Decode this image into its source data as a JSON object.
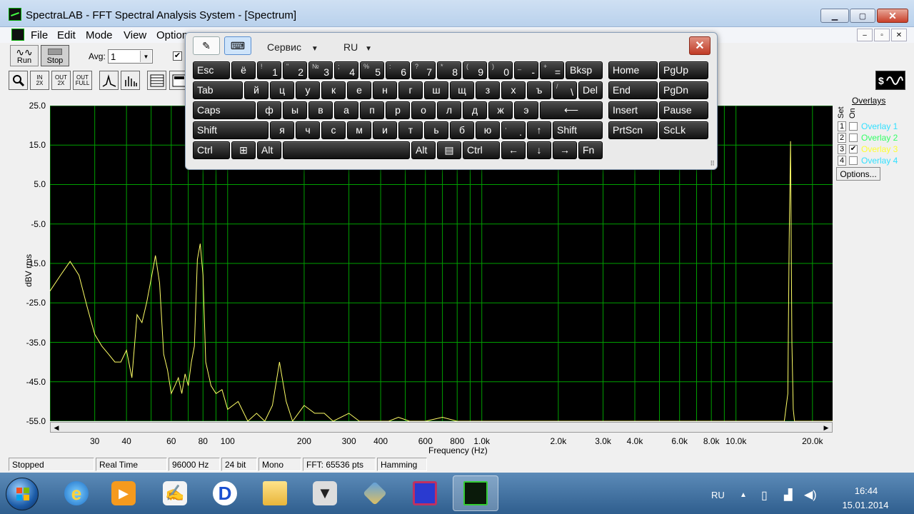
{
  "window": {
    "title": "SpectraLAB - FFT Spectral Analysis System - [Spectrum]",
    "minimize": "▁",
    "maximize": "▢",
    "close": "✕"
  },
  "menu": {
    "items": [
      "File",
      "Edit",
      "Mode",
      "View",
      "Options"
    ],
    "mdi": [
      "–",
      "▫",
      "✕"
    ]
  },
  "toolbar": {
    "run_label": "Run",
    "stop_label": "Stop",
    "avg_label": "Avg:",
    "avg_value": "1",
    "check_mark": "✔",
    "zoom_buttons": [
      {
        "top": "IN",
        "bottom": "2X"
      },
      {
        "top": "OUT",
        "bottom": "2X"
      },
      {
        "top": "OUT",
        "bottom": "FULL"
      }
    ]
  },
  "plot": {
    "ylabel": "dBV rms",
    "xlabel": "Frequency (Hz)",
    "y_ticks": [
      "25.0",
      "15.0",
      "5.0",
      "-5.0",
      "-15.0",
      "-25.0",
      "-35.0",
      "-45.0",
      "-55.0"
    ],
    "x_ticks": [
      "30",
      "40",
      "60",
      "80",
      "100",
      "200",
      "300",
      "400",
      "600",
      "800",
      "1.0k",
      "2.0k",
      "3.0k",
      "4.0k",
      "6.0k",
      "8.0k",
      "10.0k",
      "20.0k"
    ]
  },
  "chart_data": {
    "type": "line",
    "xlabel": "Frequency (Hz)",
    "ylabel": "dBV rms",
    "xscale": "log",
    "xlim": [
      20,
      24000
    ],
    "ylim": [
      -55,
      25
    ],
    "grid": true,
    "background": "#000000",
    "grid_color": "#00a000",
    "series": [
      {
        "color": "#ffff66",
        "x": [
          20,
          22,
          24,
          26,
          28,
          30,
          32,
          34,
          36,
          38,
          40,
          42,
          44,
          46,
          48,
          50,
          52,
          54,
          56,
          58,
          60,
          62,
          64,
          66,
          68,
          70,
          72,
          74,
          76,
          78,
          80,
          82,
          84,
          86,
          90,
          95,
          100,
          110,
          120,
          130,
          140,
          150,
          160,
          170,
          180,
          200,
          220,
          240,
          260,
          300,
          330,
          360,
          400,
          430,
          470,
          520,
          600,
          700,
          800,
          900,
          1000,
          1500,
          2000,
          3000,
          5000,
          8000,
          10000,
          12000,
          14000,
          15000,
          15500,
          16000,
          16200,
          16400,
          16600,
          16800,
          17000,
          18000,
          20000,
          24000
        ],
        "y": [
          -22,
          -18,
          -14.5,
          -18,
          -26,
          -33,
          -36,
          -38,
          -40,
          -40,
          -37,
          -44,
          -28,
          -30,
          -25,
          -19,
          -13,
          -20,
          -38,
          -42,
          -48,
          -46,
          -44,
          -48,
          -43,
          -46,
          -40,
          -36,
          -14,
          -10,
          -18,
          -40,
          -43,
          -46,
          -48,
          -47,
          -52,
          -50,
          -55,
          -53,
          -55,
          -51,
          -40,
          -50,
          -55,
          -51,
          -53,
          -53,
          -55,
          -53,
          -55,
          -55,
          -55,
          -55,
          -54,
          -55,
          -55,
          -54,
          -55,
          -55,
          -55,
          -55,
          -55,
          -55,
          -55,
          -55,
          -55,
          -55,
          -55,
          -55,
          -55,
          -48,
          -9,
          16,
          -35,
          -52,
          -55,
          -55,
          -55,
          -55
        ]
      }
    ]
  },
  "overlays": {
    "title": "Overlays",
    "set_label": "Set",
    "on_label": "On",
    "items": [
      {
        "num": "1",
        "label": "Overlay 1",
        "checked": "",
        "color": "#33e0ff"
      },
      {
        "num": "2",
        "label": "Overlay 2",
        "checked": "",
        "color": "#33ff66"
      },
      {
        "num": "3",
        "label": "Overlay 3",
        "checked": "✔",
        "color": "#ffff33"
      },
      {
        "num": "4",
        "label": "Overlay 4",
        "checked": "",
        "color": "#33e0ff"
      }
    ],
    "options_label": "Options..."
  },
  "status": {
    "fields": [
      "Stopped",
      "Real Time",
      "96000 Hz",
      "24 bit",
      "Mono",
      "FFT: 65536 pts",
      "Hamming"
    ]
  },
  "osk": {
    "menu_service": "Сервис",
    "menu_lang": "RU",
    "close": "✕",
    "rows": [
      [
        {
          "m": "Esc",
          "w": 52
        },
        {
          "m": "ё",
          "w": 34
        },
        {
          "s": "!",
          "b": "1",
          "w": 34
        },
        {
          "s": "\"",
          "b": "2",
          "w": 34
        },
        {
          "s": "№",
          "b": "3",
          "w": 34
        },
        {
          "s": ";",
          "b": "4",
          "w": 34
        },
        {
          "s": "%",
          "b": "5",
          "w": 34
        },
        {
          "s": ":",
          "b": "6",
          "w": 34
        },
        {
          "s": "?",
          "b": "7",
          "w": 34
        },
        {
          "s": "*",
          "b": "8",
          "w": 34
        },
        {
          "s": "(",
          "b": "9",
          "w": 34
        },
        {
          "s": ")",
          "b": "0",
          "w": 34
        },
        {
          "s": "_",
          "b": "-",
          "w": 34
        },
        {
          "s": "+",
          "b": "=",
          "w": 34
        },
        {
          "m": "Bksp",
          "w": 52
        }
      ],
      [
        {
          "m": "Tab",
          "w": 70
        },
        {
          "m": "й",
          "w": 34
        },
        {
          "m": "ц",
          "w": 34
        },
        {
          "m": "у",
          "w": 34
        },
        {
          "m": "к",
          "w": 34
        },
        {
          "m": "е",
          "w": 34
        },
        {
          "m": "н",
          "w": 34
        },
        {
          "m": "г",
          "w": 34
        },
        {
          "m": "ш",
          "w": 34
        },
        {
          "m": "щ",
          "w": 34
        },
        {
          "m": "з",
          "w": 34
        },
        {
          "m": "х",
          "w": 34
        },
        {
          "m": "ъ",
          "w": 34
        },
        {
          "s": "/",
          "b": "\\",
          "w": 34
        },
        {
          "m": "Del",
          "w": 34
        }
      ],
      [
        {
          "m": "Caps",
          "w": 88
        },
        {
          "m": "ф",
          "w": 34
        },
        {
          "m": "ы",
          "w": 34
        },
        {
          "m": "в",
          "w": 34
        },
        {
          "m": "а",
          "w": 34
        },
        {
          "m": "п",
          "w": 34
        },
        {
          "m": "р",
          "w": 34
        },
        {
          "m": "о",
          "w": 34
        },
        {
          "m": "л",
          "w": 34
        },
        {
          "m": "д",
          "w": 34
        },
        {
          "m": "ж",
          "w": 34
        },
        {
          "m": "э",
          "w": 34
        },
        {
          "m": "⟵",
          "w": 88
        }
      ],
      [
        {
          "m": "Shift",
          "w": 106
        },
        {
          "m": "я",
          "w": 34
        },
        {
          "m": "ч",
          "w": 34
        },
        {
          "m": "с",
          "w": 34
        },
        {
          "m": "м",
          "w": 34
        },
        {
          "m": "и",
          "w": 34
        },
        {
          "m": "т",
          "w": 34
        },
        {
          "m": "ь",
          "w": 34
        },
        {
          "m": "б",
          "w": 34
        },
        {
          "m": "ю",
          "w": 34
        },
        {
          "s": ",",
          "b": ".",
          "w": 34
        },
        {
          "m": "↑",
          "w": 34
        },
        {
          "m": "Shift",
          "w": 70
        }
      ],
      [
        {
          "m": "Ctrl",
          "w": 52
        },
        {
          "m": "⊞",
          "w": 34
        },
        {
          "m": "Alt",
          "w": 34
        },
        {
          "m": "",
          "w": 178
        },
        {
          "m": "Alt",
          "w": 34
        },
        {
          "m": "▤",
          "w": 34
        },
        {
          "m": "Ctrl",
          "w": 52
        },
        {
          "m": "←",
          "w": 34
        },
        {
          "m": "↓",
          "w": 34
        },
        {
          "m": "→",
          "w": 34
        },
        {
          "m": "Fn",
          "w": 34
        }
      ]
    ],
    "right_keys": [
      [
        "Home",
        "PgUp"
      ],
      [
        "End",
        "PgDn"
      ],
      [
        "Insert",
        "Pause"
      ],
      [
        "PrtScn",
        "ScLk"
      ]
    ]
  },
  "taskbar": {
    "lang": "RU",
    "time": "16:44",
    "date": "15.01.2014"
  }
}
